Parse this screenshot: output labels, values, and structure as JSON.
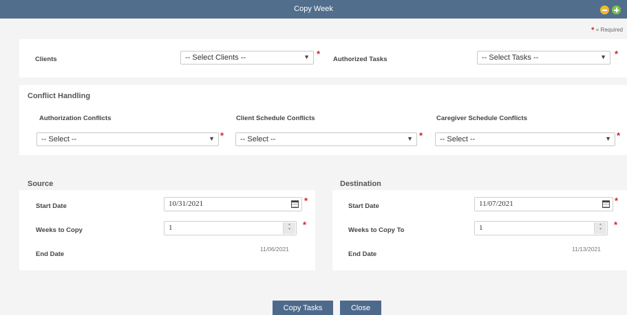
{
  "window": {
    "title": "Copy Week"
  },
  "required_note": "= Required",
  "filters": {
    "clients_label": "Clients",
    "clients_value": "-- Select Clients --",
    "tasks_label": "Authorized Tasks",
    "tasks_value": "-- Select Tasks --"
  },
  "conflict_handling": {
    "heading": "Conflict Handling",
    "authorization": {
      "label": "Authorization Conflicts",
      "value": "-- Select --"
    },
    "client_schedule": {
      "label": "Client Schedule Conflicts",
      "value": "-- Select --"
    },
    "caregiver_schedule": {
      "label": "Caregiver Schedule Conflicts",
      "value": "-- Select --"
    }
  },
  "source": {
    "heading": "Source",
    "start_date_label": "Start Date",
    "start_date": "10/31/2021",
    "weeks_label": "Weeks to Copy",
    "weeks": "1",
    "end_date_label": "End Date",
    "end_date": "11/06/2021"
  },
  "destination": {
    "heading": "Destination",
    "start_date_label": "Start Date",
    "start_date": "11/07/2021",
    "weeks_label": "Weeks to Copy To",
    "weeks": "1",
    "end_date_label": "End Date",
    "end_date": "11/13/2021"
  },
  "buttons": {
    "copy": "Copy Tasks",
    "close": "Close"
  },
  "colors": {
    "titlebar": "#526e8d",
    "button": "#4d6a8c",
    "required": "#d1222a",
    "minimize": "#f0b92c",
    "maximize": "#79c447"
  }
}
